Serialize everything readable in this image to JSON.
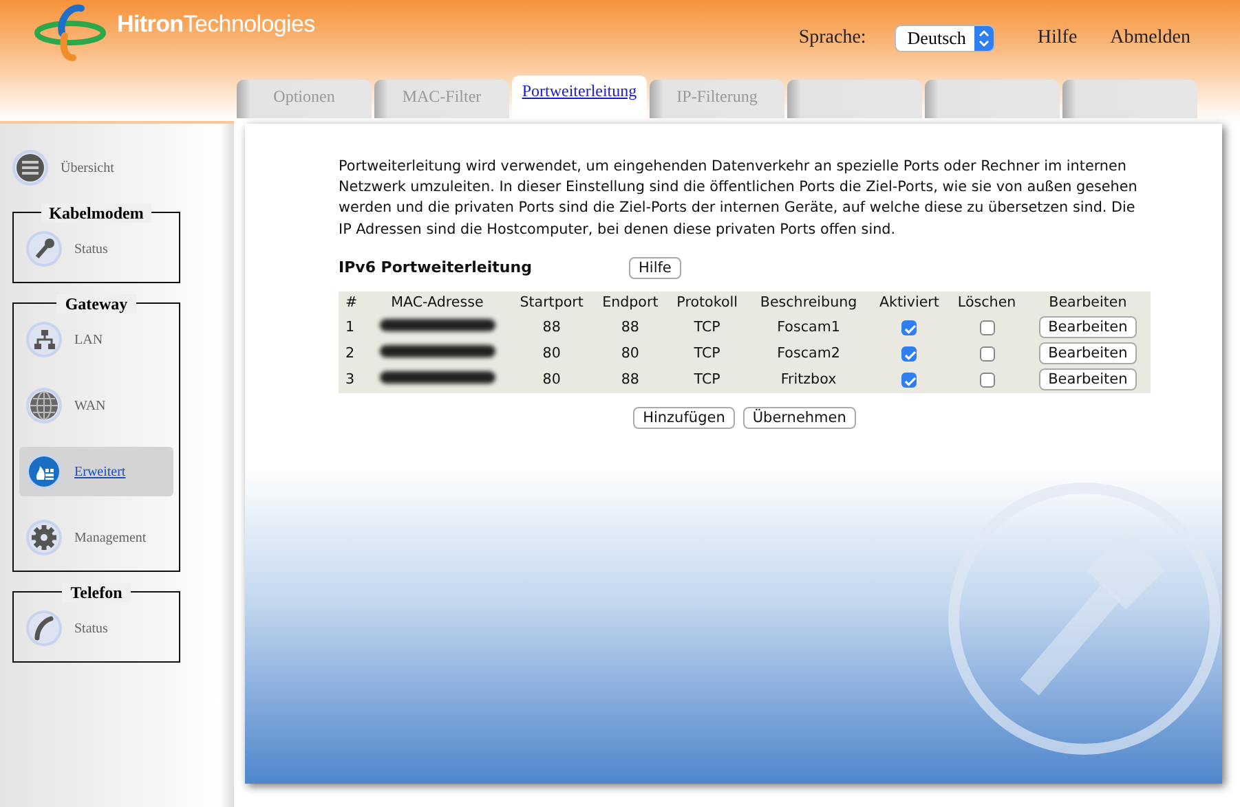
{
  "header": {
    "logo": {
      "brand_bold": "Hitron",
      "brand_rest": "Technologies"
    },
    "language_label": "Sprache:",
    "language_select": {
      "value": "Deutsch"
    },
    "links": [
      "Hilfe",
      "Abmelden"
    ]
  },
  "tabs": [
    {
      "label": "Optionen",
      "selected": false
    },
    {
      "label": "MAC-Filter",
      "selected": false
    },
    {
      "label": "Portweiterleitung",
      "selected": true
    },
    {
      "label": "IP-Filterung",
      "selected": false
    },
    {
      "selected": false
    },
    {
      "selected": false
    },
    {
      "selected": false
    }
  ],
  "sidebar": {
    "top_item": {
      "label": "Übersicht",
      "kind": "list",
      "selected": false
    },
    "groups": [
      {
        "title": "Kabelmodem",
        "items": [
          {
            "label": "Status",
            "kind": "wrench",
            "selected": false
          }
        ]
      },
      {
        "title": "Gateway",
        "items": [
          {
            "label": "LAN",
            "kind": "network",
            "selected": false
          },
          {
            "label": "WAN",
            "kind": "globe",
            "selected": false
          },
          {
            "label": "Erweitert",
            "kind": "firewall",
            "selected": true
          },
          {
            "label": "Management",
            "kind": "gear",
            "selected": false
          }
        ]
      },
      {
        "title": "Telefon",
        "items": [
          {
            "label": "Status",
            "kind": "phone",
            "selected": false
          }
        ]
      }
    ]
  },
  "content": {
    "description": "Portweiterleitung wird verwendet, um eingehenden Datenverkehr an spezielle Ports oder Rechner im internen Netzwerk umzuleiten. In dieser Einstellung sind die öffentlichen Ports die Ziel-Ports, wie sie von außen gesehen werden und die privaten Ports sind die Ziel-Ports der internen Geräte, auf welche diese zu übersetzen sind. Die IP Adressen sind die Hostcomputer, bei denen diese privaten Ports offen sind.",
    "section_title": "IPv6 Portweiterleitung",
    "help_button": "Hilfe",
    "table": {
      "columns": [
        "#",
        "MAC-Adresse",
        "Startport",
        "Endport",
        "Protokoll",
        "Beschreibung",
        "Aktiviert",
        "Löschen",
        "Bearbeiten"
      ],
      "rows": [
        {
          "index": "1",
          "mac_redacted": true,
          "startport": "88",
          "endport": "88",
          "protocol": "TCP",
          "description": "Foscam1",
          "enabled": true,
          "delete": false,
          "edit_button": "Bearbeiten"
        },
        {
          "index": "2",
          "mac_redacted": true,
          "startport": "80",
          "endport": "80",
          "protocol": "TCP",
          "description": "Foscam2",
          "enabled": true,
          "delete": false,
          "edit_button": "Bearbeiten"
        },
        {
          "index": "3",
          "mac_redacted": true,
          "startport": "80",
          "endport": "88",
          "protocol": "TCP",
          "description": "Fritzbox",
          "enabled": true,
          "delete": false,
          "edit_button": "Bearbeiten"
        }
      ]
    },
    "buttons": [
      "Hinzufügen",
      "Übernehmen"
    ]
  }
}
